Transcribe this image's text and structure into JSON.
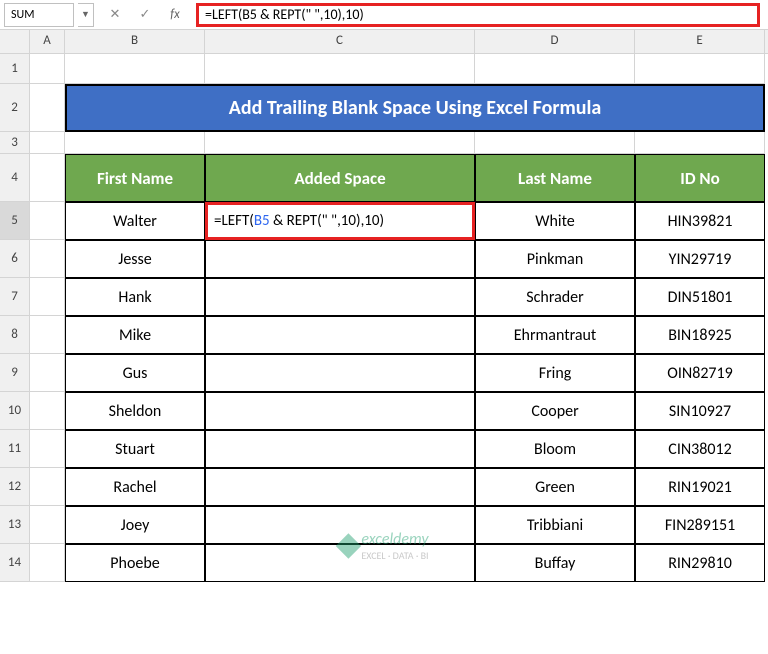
{
  "name_box": "SUM",
  "formula": "=LEFT(B5 & REPT(\" \",10),10)",
  "columns": [
    "A",
    "B",
    "C",
    "D",
    "E"
  ],
  "row_numbers": [
    1,
    2,
    3,
    4,
    5,
    6,
    7,
    8,
    9,
    10,
    11,
    12,
    13,
    14
  ],
  "title": "Add Trailing Blank Space Using Excel Formula",
  "headers": {
    "b": "First Name",
    "c": "Added Space",
    "d": "Last Name",
    "e": "ID No"
  },
  "rows": [
    {
      "first": "Walter",
      "added": "=LEFT(B5 & REPT(\" \",10),10)",
      "last": "White",
      "id": "HIN39821"
    },
    {
      "first": "Jesse",
      "added": "",
      "last": "Pinkman",
      "id": "YIN29719"
    },
    {
      "first": "Hank",
      "added": "",
      "last": "Schrader",
      "id": "DIN51801"
    },
    {
      "first": "Mike",
      "added": "",
      "last": "Ehrmantraut",
      "id": "BIN18925"
    },
    {
      "first": "Gus",
      "added": "",
      "last": "Fring",
      "id": "OIN82719"
    },
    {
      "first": "Sheldon",
      "added": "",
      "last": "Cooper",
      "id": "SIN10927"
    },
    {
      "first": "Stuart",
      "added": "",
      "last": "Bloom",
      "id": "CIN38012"
    },
    {
      "first": "Rachel",
      "added": "",
      "last": "Green",
      "id": "RIN19021"
    },
    {
      "first": "Joey",
      "added": "",
      "last": "Tribbiani",
      "id": "FIN289151"
    },
    {
      "first": "Phoebe",
      "added": "",
      "last": "Buffay",
      "id": "RIN29810"
    }
  ],
  "chart_data": {
    "type": "table",
    "title": "Add Trailing Blank Space Using Excel Formula",
    "columns": [
      "First Name",
      "Added Space",
      "Last Name",
      "ID No"
    ],
    "data": [
      [
        "Walter",
        "=LEFT(B5 & REPT(\" \",10),10)",
        "White",
        "HIN39821"
      ],
      [
        "Jesse",
        "",
        "Pinkman",
        "YIN29719"
      ],
      [
        "Hank",
        "",
        "Schrader",
        "DIN51801"
      ],
      [
        "Mike",
        "",
        "Ehrmantraut",
        "BIN18925"
      ],
      [
        "Gus",
        "",
        "Fring",
        "OIN82719"
      ],
      [
        "Sheldon",
        "",
        "Cooper",
        "SIN10927"
      ],
      [
        "Stuart",
        "",
        "Bloom",
        "CIN38012"
      ],
      [
        "Rachel",
        "",
        "Green",
        "RIN19021"
      ],
      [
        "Joey",
        "",
        "Tribbiani",
        "FIN289151"
      ],
      [
        "Phoebe",
        "",
        "Buffay",
        "RIN29810"
      ]
    ]
  },
  "watermark": {
    "brand": "exceldemy",
    "sub": "EXCEL · DATA · BI"
  }
}
